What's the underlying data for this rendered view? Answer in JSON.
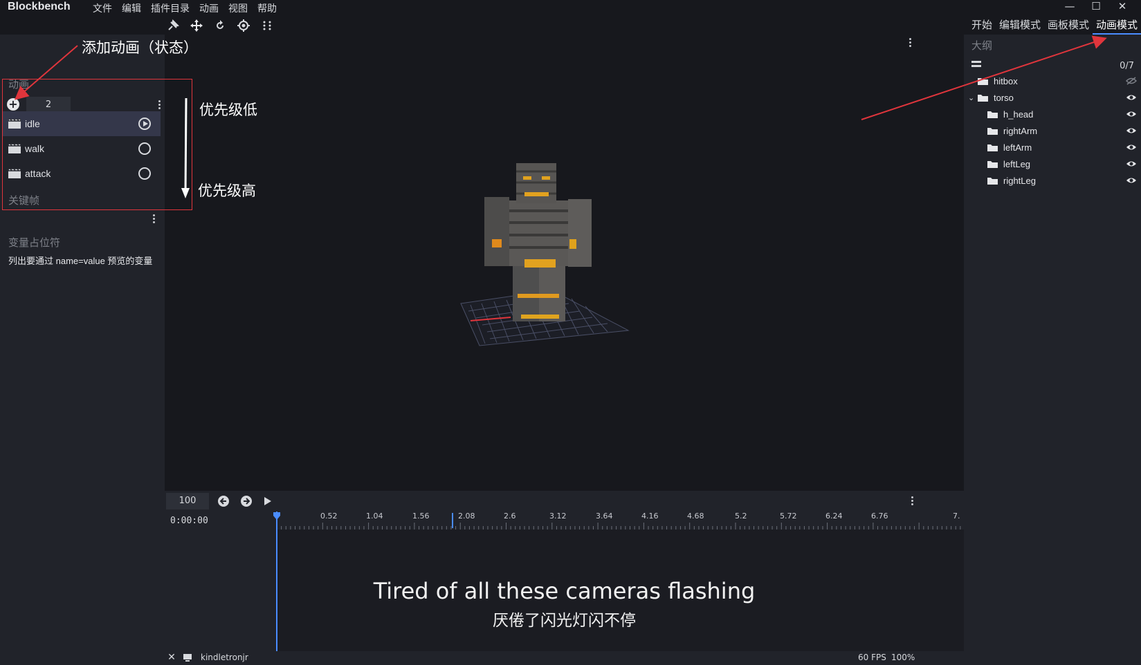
{
  "app": {
    "name": "Blockbench",
    "menu": [
      "文件",
      "编辑",
      "插件目录",
      "动画",
      "视图",
      "帮助"
    ],
    "window_controls": [
      "—",
      "☐",
      "✕"
    ]
  },
  "modes": {
    "items": [
      "开始",
      "编辑模式",
      "画板模式",
      "动画模式"
    ],
    "active": "动画模式"
  },
  "animations_panel": {
    "title": "动画",
    "count": "2",
    "items": [
      {
        "label": "idle",
        "selected": true
      },
      {
        "label": "walk",
        "selected": false
      },
      {
        "label": "attack",
        "selected": false
      }
    ]
  },
  "keyframe_panel": {
    "title": "关键帧"
  },
  "variable_panel": {
    "title": "变量占位符",
    "description": "列出要通过 name=value 预览的变量"
  },
  "outliner": {
    "title": "大纲",
    "count": "0/7",
    "nodes": [
      {
        "label": "hitbox",
        "level": 0,
        "visible": false
      },
      {
        "label": "torso",
        "level": 0,
        "visible": true,
        "expanded": true
      },
      {
        "label": "h_head",
        "level": 1,
        "visible": true
      },
      {
        "label": "rightArm",
        "level": 1,
        "visible": true
      },
      {
        "label": "leftArm",
        "level": 1,
        "visible": true
      },
      {
        "label": "leftLeg",
        "level": 1,
        "visible": true
      },
      {
        "label": "rightLeg",
        "level": 1,
        "visible": true
      }
    ]
  },
  "timeline": {
    "zoom": "100",
    "time": "0:00:00",
    "ticks": [
      "0.52",
      "1.04",
      "1.56",
      "2.08",
      "2.6",
      "3.12",
      "3.64",
      "4.16",
      "4.68",
      "5.2",
      "5.72",
      "6.24",
      "6.76",
      "7."
    ]
  },
  "subtitles": {
    "en": "Tired of all these cameras flashing",
    "zh": "厌倦了闪光灯闪不停"
  },
  "status": {
    "user": "kindletronjr",
    "fps": "60 FPS",
    "zoom": "100%"
  },
  "annotations": {
    "add_animation": "添加动画（状态）",
    "priority_low": "优先级低",
    "priority_high": "优先级高"
  },
  "colors": {
    "accent": "#4a8cff",
    "annotation_red": "#e0353c",
    "panel": "#21232a",
    "viewport": "#17181d"
  }
}
